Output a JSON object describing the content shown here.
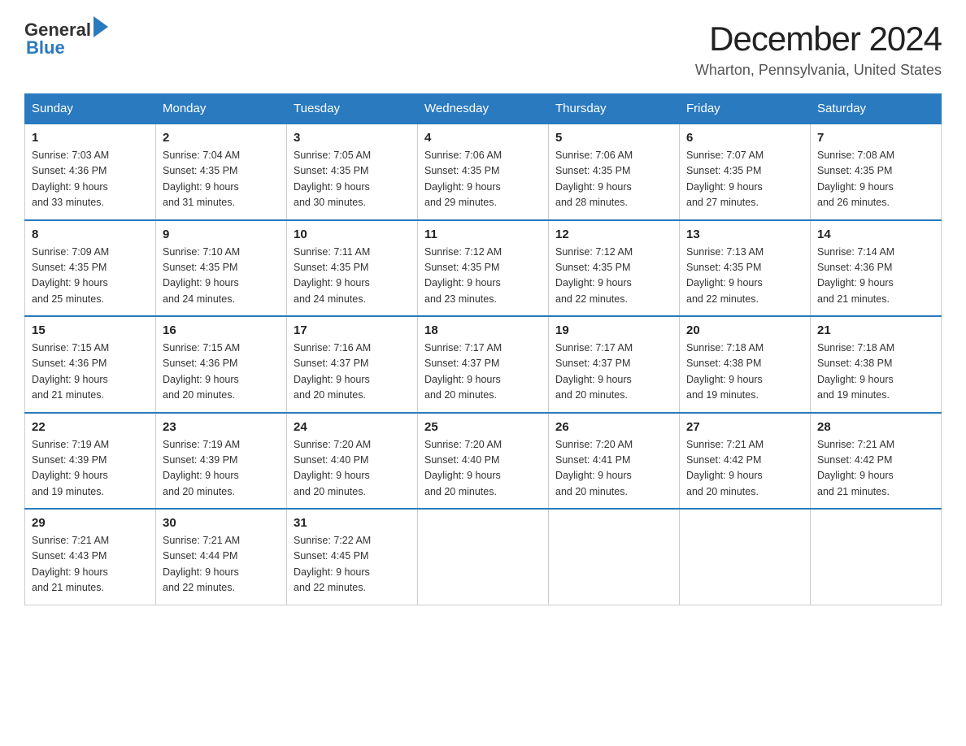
{
  "header": {
    "logo_general": "General",
    "logo_blue": "Blue",
    "title": "December 2024",
    "subtitle": "Wharton, Pennsylvania, United States"
  },
  "weekdays": [
    "Sunday",
    "Monday",
    "Tuesday",
    "Wednesday",
    "Thursday",
    "Friday",
    "Saturday"
  ],
  "weeks": [
    [
      {
        "day": "1",
        "sunrise": "7:03 AM",
        "sunset": "4:36 PM",
        "daylight": "9 hours and 33 minutes."
      },
      {
        "day": "2",
        "sunrise": "7:04 AM",
        "sunset": "4:35 PM",
        "daylight": "9 hours and 31 minutes."
      },
      {
        "day": "3",
        "sunrise": "7:05 AM",
        "sunset": "4:35 PM",
        "daylight": "9 hours and 30 minutes."
      },
      {
        "day": "4",
        "sunrise": "7:06 AM",
        "sunset": "4:35 PM",
        "daylight": "9 hours and 29 minutes."
      },
      {
        "day": "5",
        "sunrise": "7:06 AM",
        "sunset": "4:35 PM",
        "daylight": "9 hours and 28 minutes."
      },
      {
        "day": "6",
        "sunrise": "7:07 AM",
        "sunset": "4:35 PM",
        "daylight": "9 hours and 27 minutes."
      },
      {
        "day": "7",
        "sunrise": "7:08 AM",
        "sunset": "4:35 PM",
        "daylight": "9 hours and 26 minutes."
      }
    ],
    [
      {
        "day": "8",
        "sunrise": "7:09 AM",
        "sunset": "4:35 PM",
        "daylight": "9 hours and 25 minutes."
      },
      {
        "day": "9",
        "sunrise": "7:10 AM",
        "sunset": "4:35 PM",
        "daylight": "9 hours and 24 minutes."
      },
      {
        "day": "10",
        "sunrise": "7:11 AM",
        "sunset": "4:35 PM",
        "daylight": "9 hours and 24 minutes."
      },
      {
        "day": "11",
        "sunrise": "7:12 AM",
        "sunset": "4:35 PM",
        "daylight": "9 hours and 23 minutes."
      },
      {
        "day": "12",
        "sunrise": "7:12 AM",
        "sunset": "4:35 PM",
        "daylight": "9 hours and 22 minutes."
      },
      {
        "day": "13",
        "sunrise": "7:13 AM",
        "sunset": "4:35 PM",
        "daylight": "9 hours and 22 minutes."
      },
      {
        "day": "14",
        "sunrise": "7:14 AM",
        "sunset": "4:36 PM",
        "daylight": "9 hours and 21 minutes."
      }
    ],
    [
      {
        "day": "15",
        "sunrise": "7:15 AM",
        "sunset": "4:36 PM",
        "daylight": "9 hours and 21 minutes."
      },
      {
        "day": "16",
        "sunrise": "7:15 AM",
        "sunset": "4:36 PM",
        "daylight": "9 hours and 20 minutes."
      },
      {
        "day": "17",
        "sunrise": "7:16 AM",
        "sunset": "4:37 PM",
        "daylight": "9 hours and 20 minutes."
      },
      {
        "day": "18",
        "sunrise": "7:17 AM",
        "sunset": "4:37 PM",
        "daylight": "9 hours and 20 minutes."
      },
      {
        "day": "19",
        "sunrise": "7:17 AM",
        "sunset": "4:37 PM",
        "daylight": "9 hours and 20 minutes."
      },
      {
        "day": "20",
        "sunrise": "7:18 AM",
        "sunset": "4:38 PM",
        "daylight": "9 hours and 19 minutes."
      },
      {
        "day": "21",
        "sunrise": "7:18 AM",
        "sunset": "4:38 PM",
        "daylight": "9 hours and 19 minutes."
      }
    ],
    [
      {
        "day": "22",
        "sunrise": "7:19 AM",
        "sunset": "4:39 PM",
        "daylight": "9 hours and 19 minutes."
      },
      {
        "day": "23",
        "sunrise": "7:19 AM",
        "sunset": "4:39 PM",
        "daylight": "9 hours and 20 minutes."
      },
      {
        "day": "24",
        "sunrise": "7:20 AM",
        "sunset": "4:40 PM",
        "daylight": "9 hours and 20 minutes."
      },
      {
        "day": "25",
        "sunrise": "7:20 AM",
        "sunset": "4:40 PM",
        "daylight": "9 hours and 20 minutes."
      },
      {
        "day": "26",
        "sunrise": "7:20 AM",
        "sunset": "4:41 PM",
        "daylight": "9 hours and 20 minutes."
      },
      {
        "day": "27",
        "sunrise": "7:21 AM",
        "sunset": "4:42 PM",
        "daylight": "9 hours and 20 minutes."
      },
      {
        "day": "28",
        "sunrise": "7:21 AM",
        "sunset": "4:42 PM",
        "daylight": "9 hours and 21 minutes."
      }
    ],
    [
      {
        "day": "29",
        "sunrise": "7:21 AM",
        "sunset": "4:43 PM",
        "daylight": "9 hours and 21 minutes."
      },
      {
        "day": "30",
        "sunrise": "7:21 AM",
        "sunset": "4:44 PM",
        "daylight": "9 hours and 22 minutes."
      },
      {
        "day": "31",
        "sunrise": "7:22 AM",
        "sunset": "4:45 PM",
        "daylight": "9 hours and 22 minutes."
      },
      null,
      null,
      null,
      null
    ]
  ],
  "labels": {
    "sunrise": "Sunrise:",
    "sunset": "Sunset:",
    "daylight": "Daylight:"
  }
}
